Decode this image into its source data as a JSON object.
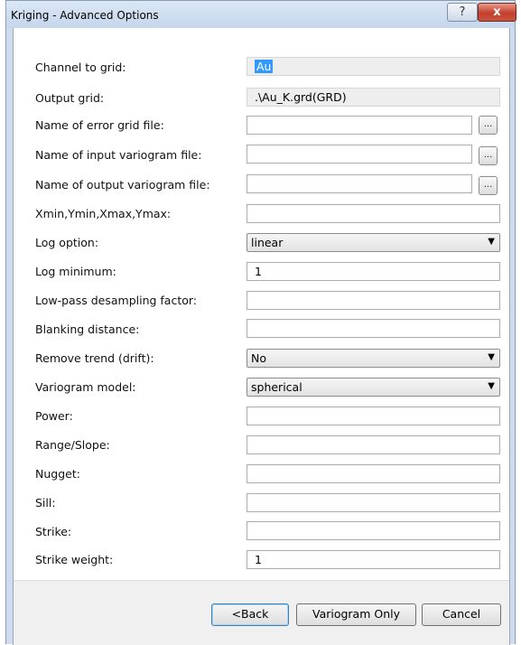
{
  "window": {
    "title": "Kriging - Advanced Options",
    "help_label": "?",
    "close_label": "x"
  },
  "fields": {
    "channel_to_grid": {
      "label": "Channel to grid:",
      "value": "Au"
    },
    "output_grid": {
      "label": "Output grid:",
      "value": ".\\Au_K.grd(GRD)"
    },
    "error_grid_file": {
      "label": "Name of error grid file:",
      "value": ""
    },
    "input_variogram_file": {
      "label": "Name of input variogram file:",
      "value": ""
    },
    "output_variogram_file": {
      "label": "Name of output variogram file:",
      "value": ""
    },
    "extents": {
      "label": "Xmin,Ymin,Xmax,Ymax:",
      "value": ""
    },
    "log_option": {
      "label": "Log option:",
      "value": "linear"
    },
    "log_minimum": {
      "label": "Log minimum:",
      "value": "1"
    },
    "lowpass_factor": {
      "label": "Low-pass desampling factor:",
      "value": ""
    },
    "blanking_distance": {
      "label": "Blanking distance:",
      "value": ""
    },
    "remove_trend": {
      "label": "Remove trend (drift):",
      "value": "No"
    },
    "variogram_model": {
      "label": "Variogram model:",
      "value": "spherical"
    },
    "power": {
      "label": "Power:",
      "value": ""
    },
    "range_slope": {
      "label": "Range/Slope:",
      "value": ""
    },
    "nugget": {
      "label": "Nugget:",
      "value": ""
    },
    "sill": {
      "label": "Sill:",
      "value": ""
    },
    "strike": {
      "label": "Strike:",
      "value": ""
    },
    "strike_weight": {
      "label": "Strike weight:",
      "value": "1"
    }
  },
  "browse_label": "...",
  "buttons": {
    "back": "<Back",
    "variogram_only": "Variogram Only",
    "cancel": "Cancel"
  }
}
